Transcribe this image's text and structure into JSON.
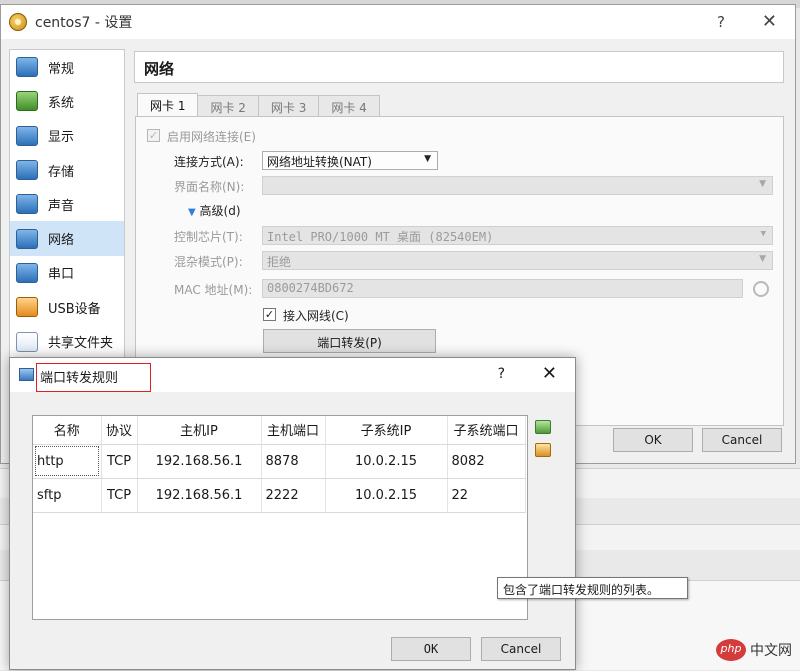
{
  "window": {
    "title": "centos7 - 设置",
    "help": "?",
    "close": "✕"
  },
  "sidebar": {
    "items": [
      {
        "label": "常规",
        "icon": "monitor-icon"
      },
      {
        "label": "系统",
        "icon": "chip-icon"
      },
      {
        "label": "显示",
        "icon": "display-icon"
      },
      {
        "label": "存储",
        "icon": "storage-icon"
      },
      {
        "label": "声音",
        "icon": "speaker-icon"
      },
      {
        "label": "网络",
        "icon": "network-icon"
      },
      {
        "label": "串口",
        "icon": "serial-port-icon"
      },
      {
        "label": "USB设备",
        "icon": "usb-icon"
      },
      {
        "label": "共享文件夹",
        "icon": "folder-icon"
      }
    ]
  },
  "page": {
    "title": "网络",
    "tabs": [
      "网卡 1",
      "网卡 2",
      "网卡 3",
      "网卡 4"
    ],
    "enable_adapter": "启用网络连接(E)",
    "attached_to_label": "连接方式(A):",
    "attached_to_value": "网络地址转换(NAT)",
    "name_label": "界面名称(N):",
    "advanced_label": "高级(d)",
    "adapter_type_label": "控制芯片(T):",
    "adapter_type_value": "Intel PRO/1000 MT 桌面 (82540EM)",
    "promiscuous_label": "混杂模式(P):",
    "promiscuous_value": "拒绝",
    "mac_label": "MAC 地址(M):",
    "mac_value": "0800274BD672",
    "cable_connected": "接入网线(C)",
    "port_forwarding_button": "端口转发(P)",
    "ok": "OK",
    "cancel": "Cancel"
  },
  "dialog": {
    "title": "端口转发规则",
    "help": "?",
    "close": "✕",
    "columns": [
      "名称",
      "协议",
      "主机IP",
      "主机端口",
      "子系统IP",
      "子系统端口"
    ],
    "rows": [
      [
        "http",
        "TCP",
        "192.168.56.1",
        "8878",
        "10.0.2.15",
        "8082"
      ],
      [
        "sftp",
        "TCP",
        "192.168.56.1",
        "2222",
        "10.0.2.15",
        "22"
      ]
    ],
    "tooltip": "包含了端口转发规则的列表。",
    "ok": "OK",
    "cancel": "Cancel"
  },
  "watermark": {
    "logo": "php",
    "text": "中文网"
  }
}
